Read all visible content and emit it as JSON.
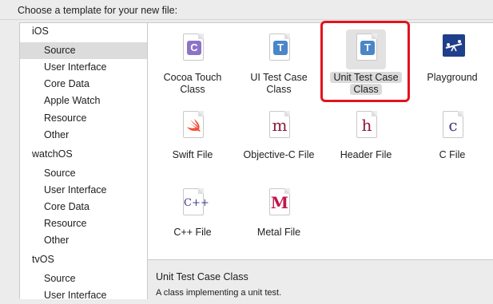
{
  "prompt": "Choose a template for your new file:",
  "sidebar": {
    "items": [
      {
        "label": "iOS",
        "kind": "platform"
      },
      {
        "label": "Source",
        "kind": "category",
        "selected": true
      },
      {
        "label": "User Interface",
        "kind": "category"
      },
      {
        "label": "Core Data",
        "kind": "category"
      },
      {
        "label": "Apple Watch",
        "kind": "category"
      },
      {
        "label": "Resource",
        "kind": "category"
      },
      {
        "label": "Other",
        "kind": "category"
      },
      {
        "label": "watchOS",
        "kind": "platform"
      },
      {
        "label": "Source",
        "kind": "category"
      },
      {
        "label": "User Interface",
        "kind": "category"
      },
      {
        "label": "Core Data",
        "kind": "category"
      },
      {
        "label": "Resource",
        "kind": "category"
      },
      {
        "label": "Other",
        "kind": "category"
      },
      {
        "label": "tvOS",
        "kind": "platform"
      },
      {
        "label": "Source",
        "kind": "category"
      },
      {
        "label": "User Interface",
        "kind": "category"
      }
    ]
  },
  "templates": [
    {
      "label": "Cocoa Touch Class",
      "line1": "Cocoa Touch",
      "line2": "Class",
      "icon": "cocoa-touch-class-icon",
      "glyph": "C"
    },
    {
      "label": "UI Test Case Class",
      "line1": "UI Test Case",
      "line2": "Class",
      "icon": "ui-test-case-class-icon",
      "glyph": "T"
    },
    {
      "label": "Unit Test Case Class",
      "line1": "Unit Test Case",
      "line2": "Class",
      "icon": "unit-test-case-class-icon",
      "glyph": "T",
      "selected": true
    },
    {
      "label": "Playground",
      "line1": "Playground",
      "line2": "",
      "icon": "playground-icon"
    },
    {
      "label": "Swift File",
      "line1": "Swift File",
      "line2": "",
      "icon": "swift-file-icon"
    },
    {
      "label": "Objective-C File",
      "line1": "Objective-C File",
      "line2": "",
      "icon": "objective-c-file-icon",
      "glyph": "m"
    },
    {
      "label": "Header File",
      "line1": "Header File",
      "line2": "",
      "icon": "header-file-icon",
      "glyph": "h"
    },
    {
      "label": "C File",
      "line1": "C File",
      "line2": "",
      "icon": "c-file-icon",
      "glyph": "c"
    },
    {
      "label": "C++ File",
      "line1": "C++ File",
      "line2": "",
      "icon": "cpp-file-icon",
      "glyph": "C++"
    },
    {
      "label": "Metal File",
      "line1": "Metal File",
      "line2": "",
      "icon": "metal-file-icon",
      "glyph": "M"
    }
  ],
  "description": {
    "title": "Unit Test Case Class",
    "body": "A class implementing a unit test."
  },
  "colors": {
    "selection_highlight": "#e3131d",
    "class_badge_purple": "#8c73c8",
    "test_badge_blue": "#4a86c8",
    "glyph_maroon": "#8b1a3a",
    "swift_orange": "#f05138",
    "playground_navy": "#1f3e8b"
  }
}
